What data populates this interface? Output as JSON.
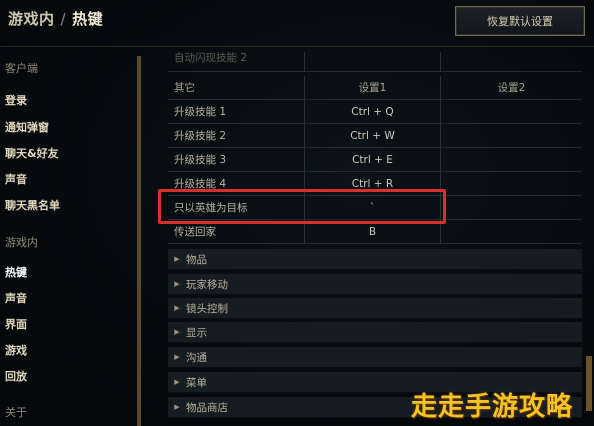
{
  "header": {
    "breadcrumb_parent": "游戏内",
    "breadcrumb_separator": "/",
    "breadcrumb_current": "热键",
    "reset_button": "恢复默认设置"
  },
  "sidebar": {
    "client_section": "客户端",
    "client_items": [
      "登录",
      "通知弹窗",
      "聊天&好友",
      "声音",
      "聊天黑名单"
    ],
    "ingame_section": "游戏内",
    "ingame_items": [
      "热键",
      "声音",
      "界面",
      "游戏",
      "回放"
    ],
    "about_section": "关于"
  },
  "table": {
    "faded_row": "自动闪现技能 2",
    "header": {
      "name": "其它",
      "col1": "设置1",
      "col2": "设置2"
    },
    "rows": [
      {
        "name": "升级技能 1",
        "key1": "Ctrl + Q",
        "key2": ""
      },
      {
        "name": "升级技能 2",
        "key1": "Ctrl + W",
        "key2": ""
      },
      {
        "name": "升级技能 3",
        "key1": "Ctrl + E",
        "key2": ""
      },
      {
        "name": "升级技能 4",
        "key1": "Ctrl + R",
        "key2": ""
      },
      {
        "name": "只以英雄为目标",
        "key1": "`",
        "key2": ""
      },
      {
        "name": "传送回家",
        "key1": "B",
        "key2": ""
      }
    ]
  },
  "categories": [
    "物品",
    "玩家移动",
    "镜头控制",
    "显示",
    "沟通",
    "菜单",
    "物品商店"
  ],
  "icons": {
    "collapsed": "triangle-right-icon"
  },
  "watermark": "走走手游攻略",
  "colors": {
    "highlight": "#d9302c",
    "accent": "#7a6a43",
    "watermark": "#f3c327"
  }
}
